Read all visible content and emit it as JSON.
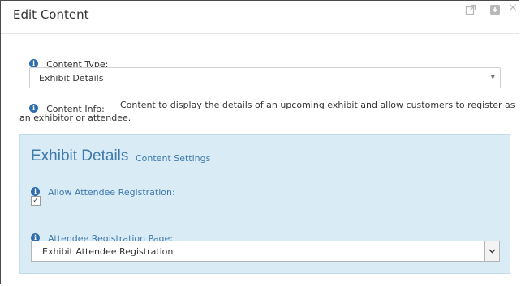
{
  "dialog": {
    "title": "Edit Content",
    "icons": [
      "external-link-icon",
      "plus-icon",
      "close-icon"
    ]
  },
  "content_type": {
    "label": "Content Type:",
    "value": "Exhibit Details"
  },
  "content_info": {
    "label": "Content Info:",
    "text_line1": "Content to display the details of an upcoming exhibit and allow customers to register as",
    "text_line2": "an exhibitor or attendee."
  },
  "panel": {
    "title": "Exhibit Details",
    "subtitle": "Content Settings",
    "allow_registration": {
      "label": "Allow Attendee Registration:",
      "checked": true,
      "mark": "✓"
    },
    "registration_page": {
      "label": "Attendee Registration Page:",
      "value": "Exhibit Attendee Registration"
    }
  },
  "colors": {
    "accent": "#3f79ad",
    "panel_bg": "#d9ebf5",
    "info_icon": "#2f6fb0"
  }
}
